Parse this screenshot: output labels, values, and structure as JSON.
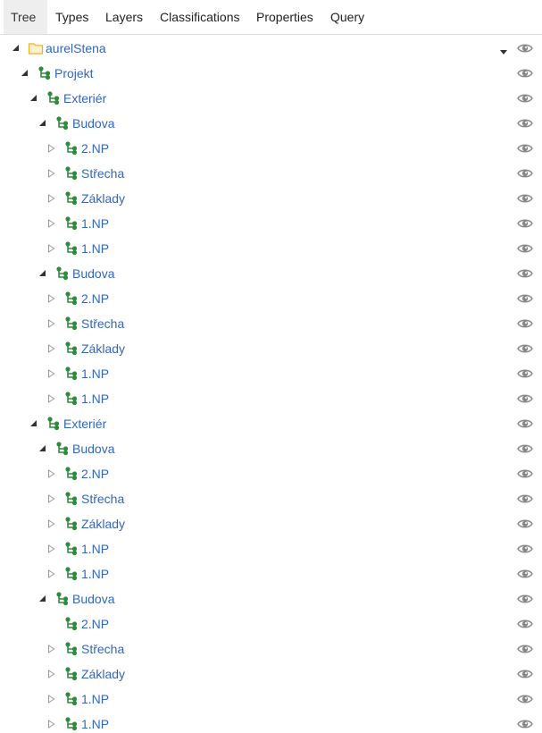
{
  "tabs": [
    {
      "label": "Tree",
      "active": true
    },
    {
      "label": "Types",
      "active": false
    },
    {
      "label": "Layers",
      "active": false
    },
    {
      "label": "Classifications",
      "active": false
    },
    {
      "label": "Properties",
      "active": false
    },
    {
      "label": "Query",
      "active": false
    }
  ],
  "colors": {
    "label": "#3366bb",
    "node_icon": "#2e8b3e",
    "folder_icon": "#e8b030",
    "eye": "#888888"
  },
  "tree": [
    {
      "label": "aurelStena",
      "icon": "folder-icon",
      "state": "expanded",
      "depth": 0,
      "caret": true
    },
    {
      "label": "Projekt",
      "icon": "node-icon",
      "state": "expanded",
      "depth": 1
    },
    {
      "label": "Exteriér",
      "icon": "node-icon",
      "state": "expanded",
      "depth": 2
    },
    {
      "label": "Budova",
      "icon": "node-icon",
      "state": "expanded",
      "depth": 3
    },
    {
      "label": "2.NP",
      "icon": "node-icon",
      "state": "collapsed",
      "depth": 4
    },
    {
      "label": "Střecha",
      "icon": "node-icon",
      "state": "collapsed",
      "depth": 4
    },
    {
      "label": "Základy",
      "icon": "node-icon",
      "state": "collapsed",
      "depth": 4
    },
    {
      "label": "1.NP",
      "icon": "node-icon",
      "state": "collapsed",
      "depth": 4
    },
    {
      "label": "1.NP",
      "icon": "node-icon",
      "state": "collapsed",
      "depth": 4
    },
    {
      "label": "Budova",
      "icon": "node-icon",
      "state": "expanded",
      "depth": 3
    },
    {
      "label": "2.NP",
      "icon": "node-icon",
      "state": "collapsed",
      "depth": 4
    },
    {
      "label": "Střecha",
      "icon": "node-icon",
      "state": "collapsed",
      "depth": 4
    },
    {
      "label": "Základy",
      "icon": "node-icon",
      "state": "collapsed",
      "depth": 4
    },
    {
      "label": "1.NP",
      "icon": "node-icon",
      "state": "collapsed",
      "depth": 4
    },
    {
      "label": "1.NP",
      "icon": "node-icon",
      "state": "collapsed",
      "depth": 4
    },
    {
      "label": "Exteriér",
      "icon": "node-icon",
      "state": "expanded",
      "depth": 2
    },
    {
      "label": "Budova",
      "icon": "node-icon",
      "state": "expanded",
      "depth": 3
    },
    {
      "label": "2.NP",
      "icon": "node-icon",
      "state": "collapsed",
      "depth": 4
    },
    {
      "label": "Střecha",
      "icon": "node-icon",
      "state": "collapsed",
      "depth": 4
    },
    {
      "label": "Základy",
      "icon": "node-icon",
      "state": "collapsed",
      "depth": 4
    },
    {
      "label": "1.NP",
      "icon": "node-icon",
      "state": "collapsed",
      "depth": 4
    },
    {
      "label": "1.NP",
      "icon": "node-icon",
      "state": "collapsed",
      "depth": 4
    },
    {
      "label": "Budova",
      "icon": "node-icon",
      "state": "expanded",
      "depth": 3
    },
    {
      "label": "2.NP",
      "icon": "node-icon",
      "state": "leaf",
      "depth": 4
    },
    {
      "label": "Střecha",
      "icon": "node-icon",
      "state": "collapsed",
      "depth": 4
    },
    {
      "label": "Základy",
      "icon": "node-icon",
      "state": "collapsed",
      "depth": 4
    },
    {
      "label": "1.NP",
      "icon": "node-icon",
      "state": "collapsed",
      "depth": 4
    },
    {
      "label": "1.NP",
      "icon": "node-icon",
      "state": "collapsed",
      "depth": 4
    }
  ]
}
